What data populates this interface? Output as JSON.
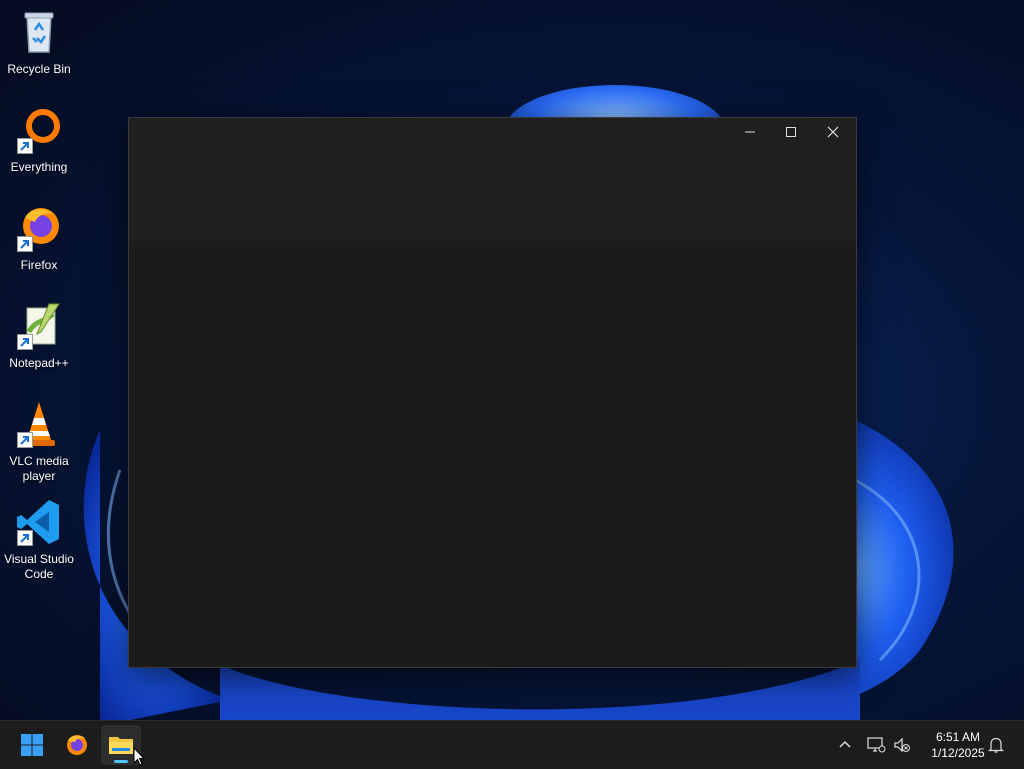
{
  "desktop": {
    "icons": [
      {
        "label": "Recycle Bin",
        "icon": "recycle-bin-icon"
      },
      {
        "label": "Everything",
        "icon": "everything-icon"
      },
      {
        "label": "Firefox",
        "icon": "firefox-icon"
      },
      {
        "label": "Notepad++",
        "icon": "notepad-plus-plus-icon"
      },
      {
        "label": "VLC media player",
        "icon": "vlc-icon"
      },
      {
        "label": "Visual Studio Code",
        "icon": "vscode-icon"
      }
    ]
  },
  "window": {
    "title": "",
    "minimize_icon": "minimize-icon",
    "maximize_icon": "maximize-icon",
    "close_icon": "close-icon"
  },
  "taskbar": {
    "start_icon": "windows-start-icon",
    "pinned": [
      "firefox-icon",
      "file-explorer-icon"
    ],
    "active_app": "file-explorer-icon",
    "tray_icons": [
      "chevron-up-icon",
      "network-icon",
      "volume-muted-icon",
      "notification-bell-icon"
    ],
    "clock": {
      "time": "6:51 AM",
      "date": "1/12/2025"
    }
  },
  "colors": {
    "accent": "#4cc2ff",
    "window_bg": "#1b1b1b",
    "taskbar_bg": "#1c1c1c"
  }
}
